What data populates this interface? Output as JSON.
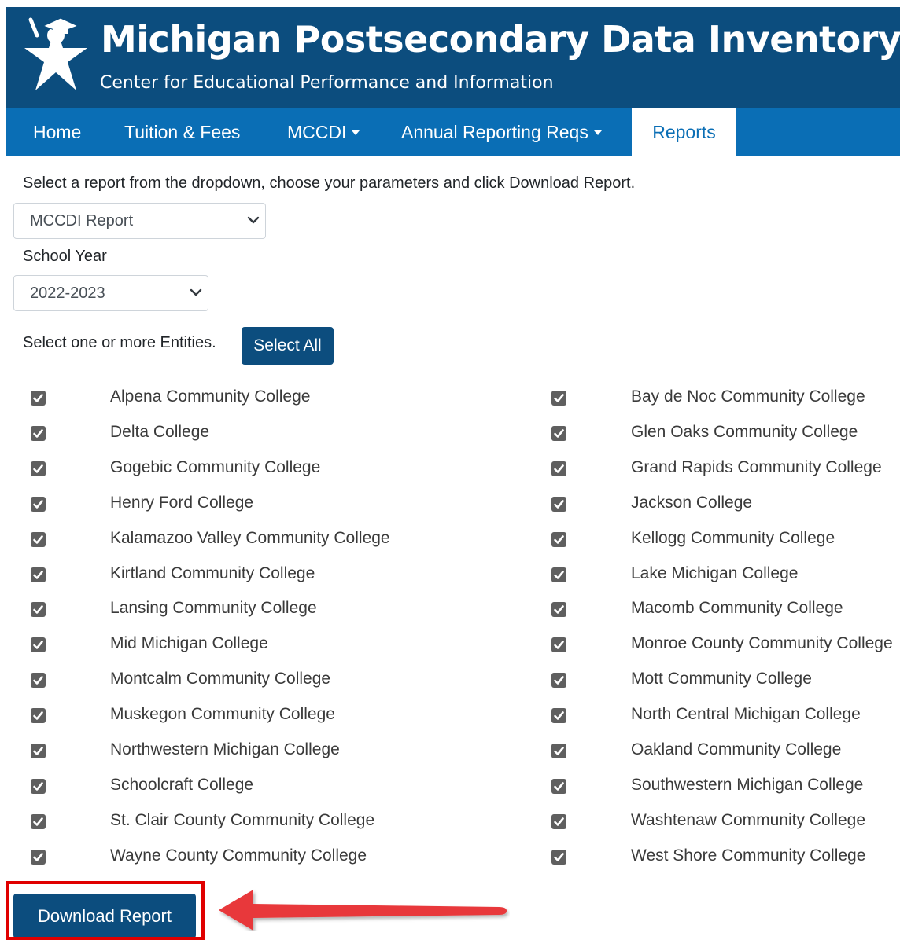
{
  "header": {
    "title": "Michigan Postsecondary Data Inventory",
    "subtitle": "Center for Educational Performance and Information",
    "logo_icon": "star-figure-graduate-logo-icon"
  },
  "nav": {
    "home": "Home",
    "tuition": "Tuition & Fees",
    "mccdi": "MCCDI",
    "annual": "Annual Reporting Reqs",
    "reports": "Reports"
  },
  "form": {
    "instructions": "Select a report from the dropdown, choose your parameters and click Download Report.",
    "report_select": "MCCDI Report",
    "school_year_label": "School Year",
    "school_year_select": "2022-2023",
    "entities_label": "Select one or more Entities.",
    "select_all": "Select All",
    "download": "Download Report"
  },
  "entities": [
    [
      "Alpena Community College",
      "Bay de Noc Community College"
    ],
    [
      "Delta College",
      "Glen Oaks Community College"
    ],
    [
      "Gogebic Community College",
      "Grand Rapids Community College"
    ],
    [
      "Henry Ford College",
      "Jackson College"
    ],
    [
      "Kalamazoo Valley Community College",
      "Kellogg Community College"
    ],
    [
      "Kirtland Community College",
      "Lake Michigan College"
    ],
    [
      "Lansing Community College",
      "Macomb Community College"
    ],
    [
      "Mid Michigan College",
      "Monroe County Community College"
    ],
    [
      "Montcalm Community College",
      "Mott Community College"
    ],
    [
      "Muskegon Community College",
      "North Central Michigan College"
    ],
    [
      "Northwestern Michigan College",
      "Oakland Community College"
    ],
    [
      "Schoolcraft College",
      "Southwestern Michigan College"
    ],
    [
      "St. Clair County Community College",
      "Washtenaw Community College"
    ],
    [
      "Wayne County Community College",
      "West Shore Community College"
    ]
  ],
  "colors": {
    "header_bg": "#0c4d7e",
    "nav_bg": "#0a6eb5",
    "button_bg": "#0c4d7e",
    "checkbox": "#5f5f5f",
    "annotation_red": "#e00000",
    "arrow_red": "#e8373a"
  }
}
